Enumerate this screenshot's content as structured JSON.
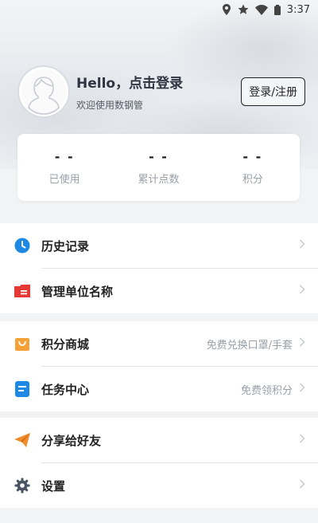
{
  "status_bar": {
    "time": "3:37"
  },
  "profile": {
    "greeting": "Hello，点击登录",
    "subtitle": "欢迎使用数钢管",
    "login_button": "登录/注册"
  },
  "stats": [
    {
      "value": "- -",
      "label": "已使用"
    },
    {
      "value": "- -",
      "label": "累计点数"
    },
    {
      "value": "- -",
      "label": "积分"
    }
  ],
  "menu": {
    "history": {
      "label": "历史记录",
      "icon": "clock-icon",
      "color": "#1e88e5"
    },
    "unit_name": {
      "label": "管理单位名称",
      "icon": "id-card-icon",
      "color": "#e53935"
    },
    "points_mall": {
      "label": "积分商城",
      "hint": "免费兑换口罩/手套",
      "icon": "shopping-bag-icon",
      "color": "#f5a13a"
    },
    "task_center": {
      "label": "任务中心",
      "hint": "免费领积分",
      "icon": "task-list-icon",
      "color": "#1e88e5"
    },
    "share": {
      "label": "分享给好友",
      "icon": "paper-plane-icon",
      "color": "#f08c2e"
    },
    "settings": {
      "label": "设置",
      "icon": "gear-icon",
      "color": "#4a5462"
    }
  }
}
